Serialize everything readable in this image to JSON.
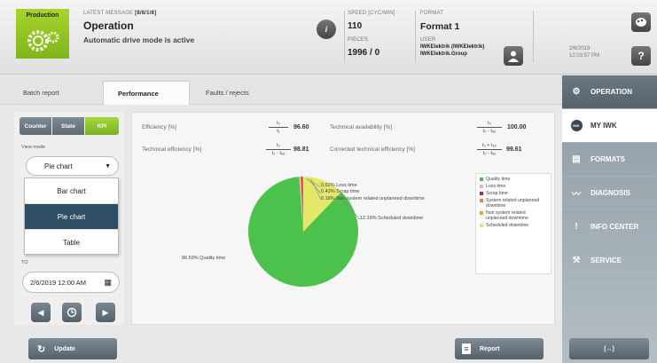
{
  "header": {
    "production_label": "Production",
    "latest_message_caption": "LATEST MESSAGE",
    "latest_message_index": "[8/8/1/8]",
    "message_title": "Operation",
    "message_text": "Automatic drive mode is active",
    "speed_caption": "SPEED [CYC/MIN]",
    "speed_value": "110",
    "pieces_caption": "PIECES",
    "pieces_value": "1996 / 0",
    "format_caption": "FORMAT",
    "format_value": "Format 1",
    "user_caption": "USER",
    "user_name": "IWKElektrik (IWKElektrik)",
    "user_group": "IWKElektrik.Group",
    "date": "2/6/2019",
    "time": "12:03:57 PM",
    "help_label": "?",
    "info_label": "i"
  },
  "tabs": [
    {
      "label": "Batch report"
    },
    {
      "label": "Performance"
    },
    {
      "label": "Faults / rejects"
    }
  ],
  "left": {
    "segments": [
      "Counter",
      "State",
      "KPI"
    ],
    "view_mode_caption": "View mode",
    "view_mode_value": "Pie chart",
    "options": [
      "Bar chart",
      "Pie chart",
      "Table"
    ],
    "to_caption": "TO",
    "to_value": "2/6/2019 12:00 AM"
  },
  "kpis": {
    "efficiency_label": "Efficiency [%]",
    "efficiency_num": "t₀",
    "efficiency_den": "t₁",
    "efficiency_value": "96.60",
    "tech_avail_label": "Technical availability [%]",
    "tech_avail_num": "t₀",
    "tech_avail_den": "t₀ - t₆ₑ",
    "tech_avail_value": "100.00",
    "tech_eff_label": "Technical efficiency [%]",
    "tech_eff_num": "t₀",
    "tech_eff_den": "t₀ - t₆ₑ",
    "tech_eff_value": "98.81",
    "corr_eff_label": "Corrected technical efficiency [%]",
    "corr_eff_num": "t₀ + t₂ₚ",
    "corr_eff_den": "t₀ - t₆ₑ",
    "corr_eff_value": "99.61"
  },
  "chart_data": {
    "type": "pie",
    "slices": [
      {
        "label": "Quality time",
        "value": 86.59,
        "color": "#4cc24c"
      },
      {
        "label": "Loss time",
        "value": 0.62,
        "color": "#e7b2c8"
      },
      {
        "label": "Scrap time",
        "value": 0.43,
        "color": "#c02a20"
      },
      {
        "label": "Non system related unplanned downtime",
        "value": 0.18,
        "color": "#f0a030"
      },
      {
        "label": "Scheduled downtime",
        "value": 12.18,
        "color": "#e4e86a"
      }
    ],
    "annotations": [
      "0.62%  Loss time",
      "0.43%  Scrap time",
      "0.18%  Non system related unplanned downtime",
      "12.18%  Scheduled downtime",
      "86.59%  Quality time"
    ],
    "legend": [
      {
        "label": "Quality time",
        "color": "#4cc24c"
      },
      {
        "label": "Loss time",
        "color": "#e7b2c8"
      },
      {
        "label": "Scrap time",
        "color": "#c02a20"
      },
      {
        "label": "System related unplanned downtime",
        "color": "#e08070"
      },
      {
        "label": "Non system related unplanned downtime",
        "color": "#f0a030"
      },
      {
        "label": "Scheduled downtime",
        "color": "#e4e86a"
      }
    ]
  },
  "bottom": {
    "update_label": "Update",
    "report_label": "Report",
    "fullscreen_label": "(↔)"
  },
  "nav": [
    {
      "label": "OPERATION",
      "icon": "gears-icon"
    },
    {
      "label": "MY IWK",
      "icon": "iwk-logo-icon"
    },
    {
      "label": "FORMATS",
      "icon": "document-icon"
    },
    {
      "label": "DIAGNOSIS",
      "icon": "waveform-icon"
    },
    {
      "label": "INFO CENTER",
      "icon": "info-icon"
    },
    {
      "label": "SERVICE",
      "icon": "wrench-icon"
    }
  ]
}
